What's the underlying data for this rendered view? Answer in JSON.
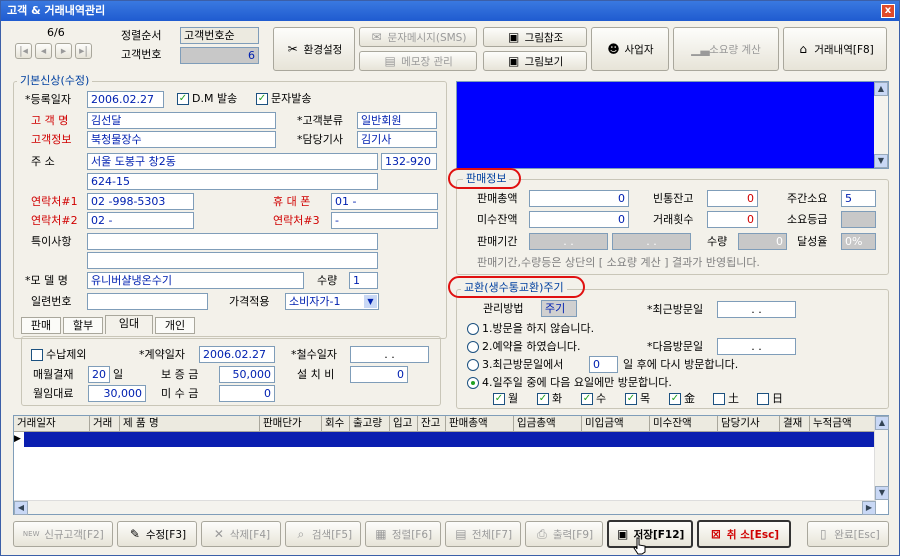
{
  "window": {
    "title": "고객 & 거래내역관리",
    "close": "x"
  },
  "nav": {
    "page": "6/6",
    "sort_label": "정렬순서",
    "sort_value": "고객번호순",
    "custno_label": "고객번호",
    "custno_value": "6"
  },
  "toolbar": {
    "env": "환경설정",
    "sms": "문자메시지(SMS)",
    "memo": "메모장 관리",
    "pic_ref": "그림참조",
    "pic_view": "그림보기",
    "biz": "사업자",
    "usage": "소요량 계산",
    "trade": "거래내역[F8]"
  },
  "basic": {
    "title": "기본신상(수정)",
    "reg_label": "*등록일자",
    "reg_value": "2006.02.27",
    "dm_label": "D.M 발송",
    "sms_label": "문자발송",
    "name_label": "고 객 명",
    "name_value": "김선달",
    "class_label": "*고객분류",
    "class_value": "일반회원",
    "info_label": "고객정보",
    "info_value": "북청물장수",
    "staff_label": "*담당기사",
    "staff_value": "김기사",
    "addr_label": "주      소",
    "addr1": "서울 도봉구 창2동",
    "zip": "132-920",
    "addr2": "624-15",
    "tel1_label": "연락처#1",
    "tel1": "02   -998-5303",
    "mobile_label": "휴 대 폰",
    "mobile": "01  -",
    "tel2_label": "연락처#2",
    "tel2": "02   -",
    "tel3_label": "연락처#3",
    "tel3": "-",
    "note_label": "특이사항",
    "model_label": "*모 델 명",
    "model_value": "유니버샬냉온수기",
    "qty_label": "수량",
    "qty_value": "1",
    "serial_label": "일련번호",
    "price_label": "가격적용",
    "price_value": "소비자가-1"
  },
  "tabs": [
    "판매",
    "할부",
    "임대",
    "개인"
  ],
  "rent": {
    "exclude_label": "수납제외",
    "contract_label": "*계약일자",
    "contract_value": "2006.02.27",
    "withdraw_label": "*철수일자",
    "withdraw_value": ".   .",
    "monthly_label": "매월결재",
    "monthly_value": "20",
    "day": "일",
    "deposit_label": "보 증 금",
    "deposit_value": "50,000",
    "install_label": "설 치 비",
    "install_value": "0",
    "fee_label": "월임대료",
    "fee_value": "30,000",
    "unpaid_label": "미 수 금",
    "unpaid_value": "0"
  },
  "sales": {
    "title": "판매정보",
    "total_label": "판매총액",
    "total_value": "0",
    "empty_label": "빈통잔고",
    "empty_value": "0",
    "week_label": "주간소요",
    "week_value": "5",
    "unpaid_label": "미수잔액",
    "unpaid_value": "0",
    "count_label": "거래횟수",
    "count_value": "0",
    "grade_label": "소요등급",
    "period_label": "판매기간",
    "period_from": ".   .",
    "period_to": ".   .",
    "qty_label": "수량",
    "qty_value": "0",
    "rate_label": "달성율",
    "rate_value": "0%",
    "note": "판매기간,수량등은 상단의 [ 소요량 계산 ] 결과가 반영됩니다."
  },
  "exchange": {
    "title": "교환(생수통교환)주기",
    "method_label": "관리방법",
    "method_value": "주기",
    "last_label": "*최근방문일",
    "last_value": ".   .",
    "next_label": "*다음방문일",
    "next_value": ".   .",
    "opt1": "1.방문을 하지 않습니다.",
    "opt2": "2.예약을 하였습니다.",
    "opt3a": "3.최근방문일에서",
    "opt3_days": "0",
    "opt3b": "일 후에 다시 방문합니다.",
    "opt4": "4.일주일 중에 다음 요일에만 방문합니다.",
    "days": [
      "월",
      "화",
      "수",
      "목",
      "金",
      "土",
      "日"
    ]
  },
  "grid": {
    "headers": [
      "거래일자",
      "거래",
      "제   품   명",
      "판매단가",
      "회수",
      "출고량",
      "입고",
      "잔고",
      "판매총액",
      "입금총액",
      "미입금액",
      "미수잔액",
      "담당기사",
      "결재",
      "누적금액"
    ]
  },
  "bottom": {
    "new": "신규고객[F2]",
    "new_badge": "NEW",
    "edit": "수정[F3]",
    "delete": "삭제[F4]",
    "search": "검색[F5]",
    "sort": "정렬[F6]",
    "all": "전체[F7]",
    "print": "출력[F9]",
    "save": "저장[F12]",
    "cancel": "취 소[Esc]",
    "done": "완료[Esc]"
  },
  "colors": {
    "accent_red": "#e01010",
    "grid_row": "#0a1eb0",
    "panel_blue": "#0000ff"
  }
}
